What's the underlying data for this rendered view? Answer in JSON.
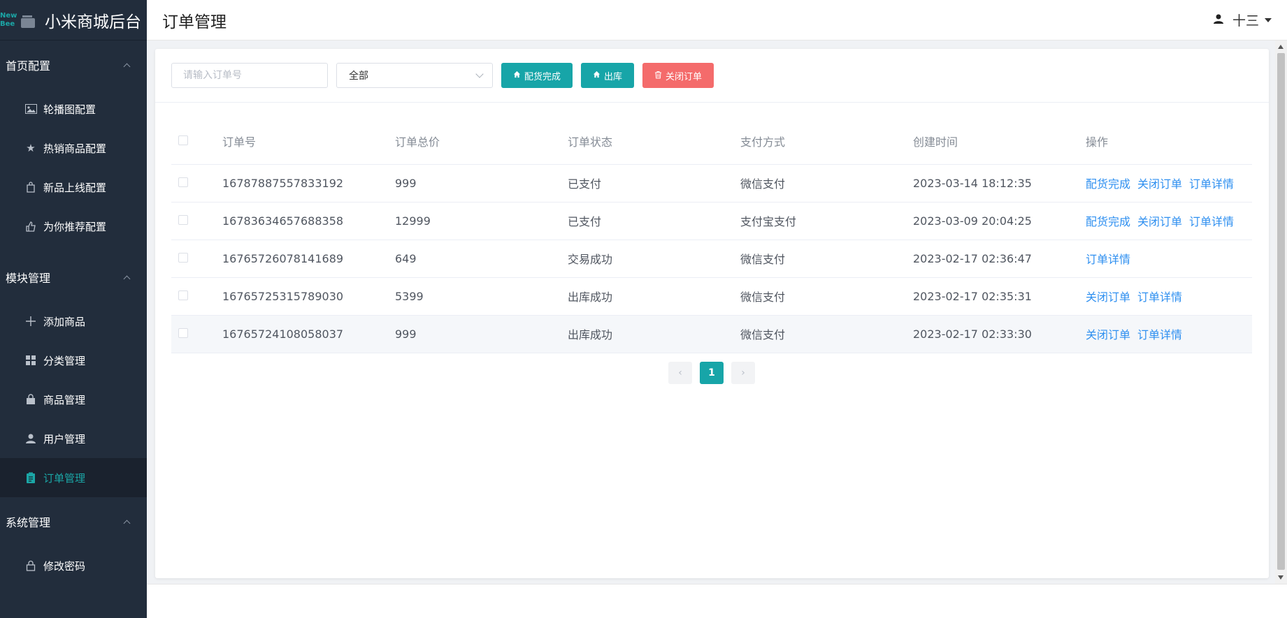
{
  "brand": {
    "logo_top": "New",
    "logo_bottom": "Bee",
    "title": "小米商城后台"
  },
  "sidebar": {
    "groups": [
      {
        "label": "首页配置",
        "items": [
          {
            "label": "轮播图配置",
            "icon": "image-icon"
          },
          {
            "label": "热销商品配置",
            "icon": "star-icon"
          },
          {
            "label": "新品上线配置",
            "icon": "new-product-icon"
          },
          {
            "label": "为你推荐配置",
            "icon": "thumb-icon"
          }
        ]
      },
      {
        "label": "模块管理",
        "items": [
          {
            "label": "添加商品",
            "icon": "plus-icon"
          },
          {
            "label": "分类管理",
            "icon": "grid-icon"
          },
          {
            "label": "商品管理",
            "icon": "bag-icon"
          },
          {
            "label": "用户管理",
            "icon": "user-icon"
          },
          {
            "label": "订单管理",
            "icon": "clipboard-icon",
            "active": true
          }
        ]
      },
      {
        "label": "系统管理",
        "items": [
          {
            "label": "修改密码",
            "icon": "lock-icon"
          }
        ]
      }
    ]
  },
  "header": {
    "title": "订单管理",
    "user": "十三"
  },
  "toolbar": {
    "search_placeholder": "请输入订单号",
    "select_value": "全部",
    "btn_pack": "配货完成",
    "btn_ship": "出库",
    "btn_close": "关闭订单"
  },
  "table": {
    "headers": [
      "订单号",
      "订单总价",
      "订单状态",
      "支付方式",
      "创建时间",
      "操作"
    ],
    "rows": [
      {
        "order": "16787887557833192",
        "price": "999",
        "status": "已支付",
        "pay": "微信支付",
        "time": "2023-03-14 18:12:35",
        "ops": [
          "配货完成",
          "关闭订单",
          "订单详情"
        ]
      },
      {
        "order": "16783634657688358",
        "price": "12999",
        "status": "已支付",
        "pay": "支付宝支付",
        "time": "2023-03-09 20:04:25",
        "ops": [
          "配货完成",
          "关闭订单",
          "订单详情"
        ]
      },
      {
        "order": "16765726078141689",
        "price": "649",
        "status": "交易成功",
        "pay": "微信支付",
        "time": "2023-02-17 02:36:47",
        "ops": [
          "订单详情"
        ]
      },
      {
        "order": "16765725315789030",
        "price": "5399",
        "status": "出库成功",
        "pay": "微信支付",
        "time": "2023-02-17 02:35:31",
        "ops": [
          "关闭订单",
          "订单详情"
        ]
      },
      {
        "order": "16765724108058037",
        "price": "999",
        "status": "出库成功",
        "pay": "微信支付",
        "time": "2023-02-17 02:33:30",
        "ops": [
          "关闭订单",
          "订单详情"
        ]
      }
    ]
  },
  "pager": {
    "prev": "‹",
    "current": "1",
    "next": "›"
  },
  "colors": {
    "accent": "#17a5a8",
    "danger": "#f46b6b",
    "link": "#2e8ff0",
    "sidebar_bg": "#222d3c"
  }
}
